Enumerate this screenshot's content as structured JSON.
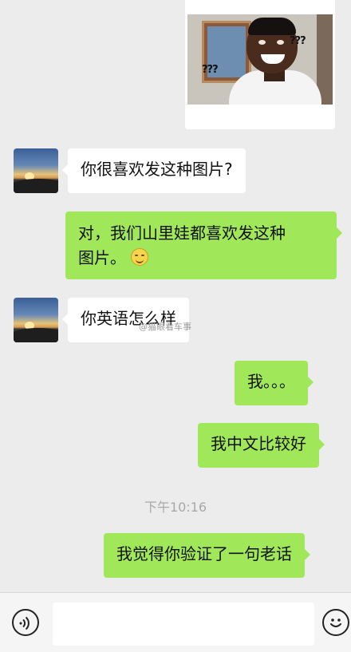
{
  "sticker": {
    "marks_left": "???",
    "marks_right": "???"
  },
  "messages": [
    {
      "side": "in",
      "text": "你很喜欢发这种图片?"
    },
    {
      "side": "out",
      "line1": "对，我们山里娃都喜欢发这种",
      "line2": "图片。"
    },
    {
      "side": "in",
      "text": "你英语怎么样"
    },
    {
      "side": "out",
      "text": "我。。。"
    },
    {
      "side": "out",
      "text": "我中文比较好"
    },
    {
      "side": "out",
      "text": "我觉得你验证了一句老话"
    }
  ],
  "watermark": "@猫眼看车事",
  "timestamp": "下午10:16",
  "icons": {
    "voice": "voice-icon",
    "emoji": "emoji-icon",
    "smiley": "smile-emoji-icon"
  }
}
